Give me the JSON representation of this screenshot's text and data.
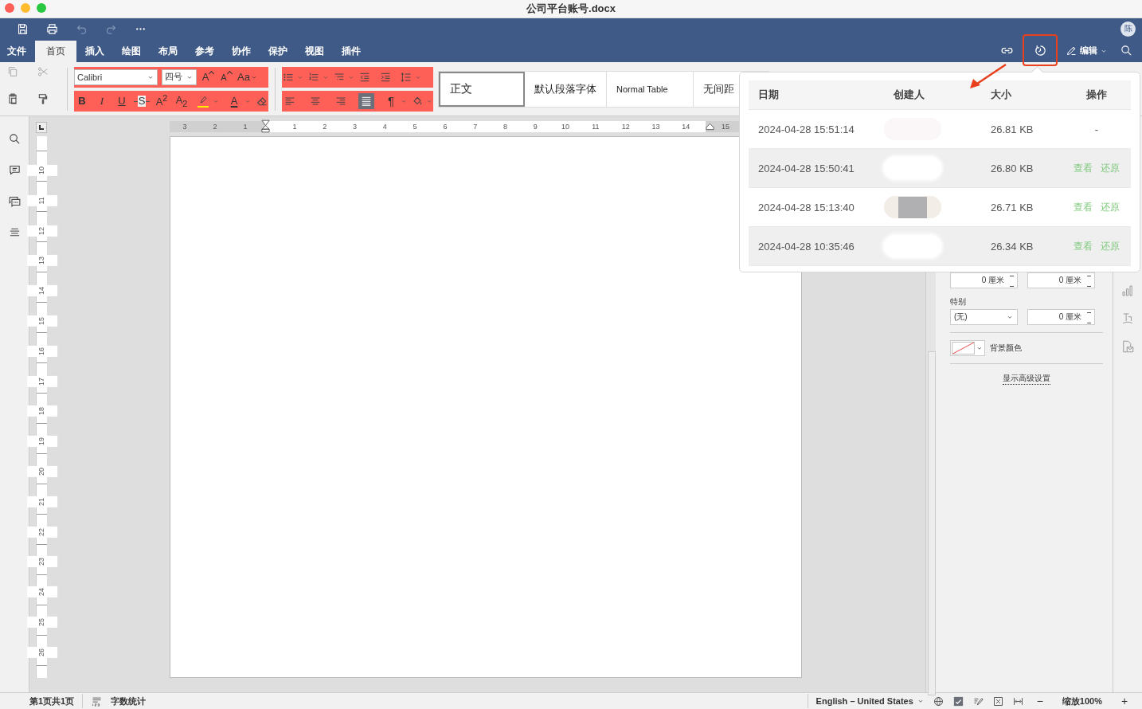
{
  "window": {
    "title": "公司平台账号.docx"
  },
  "avatar": "陈",
  "tabs": [
    {
      "label": "文件",
      "selected": false
    },
    {
      "label": "首页",
      "selected": true
    },
    {
      "label": "插入",
      "selected": false
    },
    {
      "label": "绘图",
      "selected": false
    },
    {
      "label": "布局",
      "selected": false
    },
    {
      "label": "参考",
      "selected": false
    },
    {
      "label": "协作",
      "selected": false
    },
    {
      "label": "保护",
      "selected": false
    },
    {
      "label": "视图",
      "selected": false
    },
    {
      "label": "插件",
      "selected": false
    }
  ],
  "history_button": {
    "highlighted": true
  },
  "edit_button": {
    "label": "编辑"
  },
  "toolbar": {
    "font": "Calibri",
    "size": "四号",
    "size_buttons": [
      {
        "kind": "grow",
        "label": "A"
      },
      {
        "kind": "shrink",
        "label": "A"
      },
      {
        "kind": "case",
        "label": "Aa"
      }
    ],
    "format_buttons": [
      {
        "kind": "bold",
        "label": "B"
      },
      {
        "kind": "italic",
        "label": "I"
      },
      {
        "kind": "underline",
        "label": "U"
      },
      {
        "kind": "strike",
        "label": "S"
      },
      {
        "kind": "plain",
        "label": "A$^{2}$"
      },
      {
        "kind": "plain",
        "label": "A$_{2}$"
      }
    ],
    "font_color_label": "A",
    "paragraph_mark": "¶",
    "align_buttons": [
      {
        "kind": "left",
        "selected": false
      },
      {
        "kind": "center",
        "selected": false
      },
      {
        "kind": "right",
        "selected": false
      },
      {
        "kind": "justify",
        "selected": true
      }
    ],
    "styles": [
      {
        "label": "正文",
        "selected": true
      },
      {
        "label": "默认段落字体",
        "selected": false
      },
      {
        "label": "Normal Table",
        "selected": false
      },
      {
        "label": "无间距",
        "selected": false
      }
    ]
  },
  "ruler": {
    "left_numbers": [
      "3",
      "2",
      "1"
    ],
    "numbers": [
      "1",
      "2",
      "3",
      "4",
      "5",
      "6",
      "7",
      "8",
      "9",
      "10",
      "11",
      "12",
      "13",
      "14"
    ],
    "right_numbers": [
      "15"
    ],
    "vertical_numbers": [
      "10",
      "11",
      "12",
      "13",
      "14",
      "15",
      "16",
      "17",
      "18",
      "19",
      "20",
      "21",
      "22",
      "23",
      "24",
      "25",
      "26"
    ]
  },
  "history": {
    "columns": [
      "日期",
      "创建人",
      "大小",
      "操作"
    ],
    "rows": [
      {
        "date": "2024-04-28 15:51:14",
        "kind": "blur",
        "size": "26.81 KB",
        "actions": [],
        "placeholder": "-"
      },
      {
        "date": "2024-04-28 15:50:41",
        "kind": "blur",
        "size": "26.80 KB",
        "actions": [
          "查看",
          "还原"
        ]
      },
      {
        "date": "2024-04-28 15:13:40",
        "kind": "block",
        "size": "26.71 KB",
        "actions": [
          "查看",
          "还原"
        ]
      },
      {
        "date": "2024-04-28 10:35:46",
        "kind": "blur",
        "size": "26.34 KB",
        "actions": [
          "查看",
          "还原"
        ]
      }
    ]
  },
  "panel": {
    "spin_top": [
      "0 厘米",
      "0 厘米"
    ],
    "special_label": "特别",
    "special_value": "(无)",
    "spin_special": "0 厘米",
    "bg_color_label": "背景颜色",
    "advanced_link": "显示高级设置"
  },
  "status_bar": {
    "page": "第1页共1页",
    "word_count": "字数统计",
    "language": "English – United States",
    "zoom": "缩放100%",
    "minus": "−",
    "plus": "+"
  }
}
